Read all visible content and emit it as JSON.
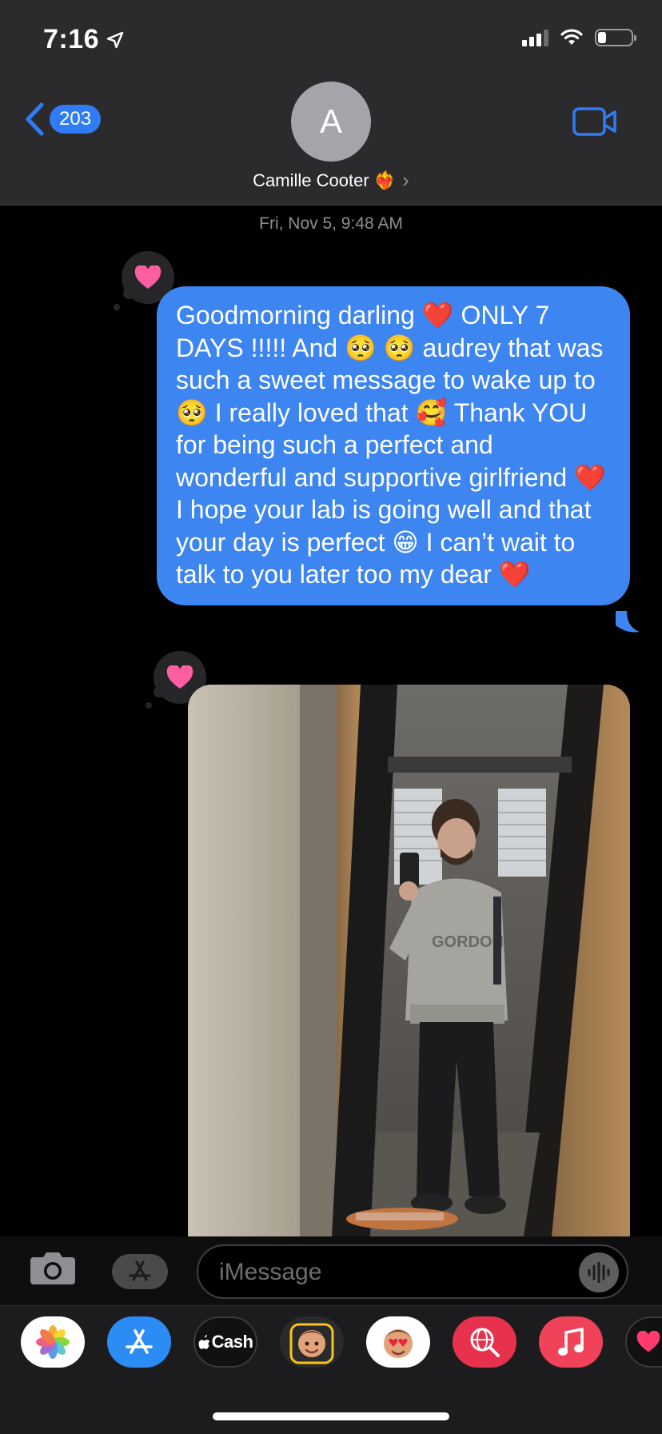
{
  "status": {
    "time": "7:16"
  },
  "header": {
    "back_count": "203",
    "avatar_initial": "A",
    "contact_name": "Camille Cooter ❤️‍🔥",
    "chevron": "›"
  },
  "conversation": {
    "timestamp": "Fri, Nov 5, 9:48 AM",
    "message_text": "Goodmorning darling ❤️ ONLY 7 DAYS !!!!! And 🥺 🥺 audrey that was such a sweet message to wake up to 🥺 I really loved that 🥰 Thank YOU for being such a perfect and wonderful and supportive girlfriend ❤️ I hope your lab is going well and that your day is perfect 😁 I can’t wait to talk to you later too my dear ❤️",
    "tapback": "heart"
  },
  "composer": {
    "placeholder": "iMessage"
  },
  "app_drawer": {
    "apps": [
      {
        "name": "Photos"
      },
      {
        "name": "App Store"
      },
      {
        "name": "Cash",
        "label": "Cash"
      },
      {
        "name": "Memoji"
      },
      {
        "name": "Memoji Stickers"
      },
      {
        "name": "Images Search"
      },
      {
        "name": "Music"
      },
      {
        "name": "Digital Touch"
      }
    ]
  },
  "colors": {
    "bubble_blue": "#3d85f0",
    "header_bg": "#2b2b2d",
    "accent_blue": "#2f7cf6",
    "tapback_heart": "#ff5fa2"
  }
}
